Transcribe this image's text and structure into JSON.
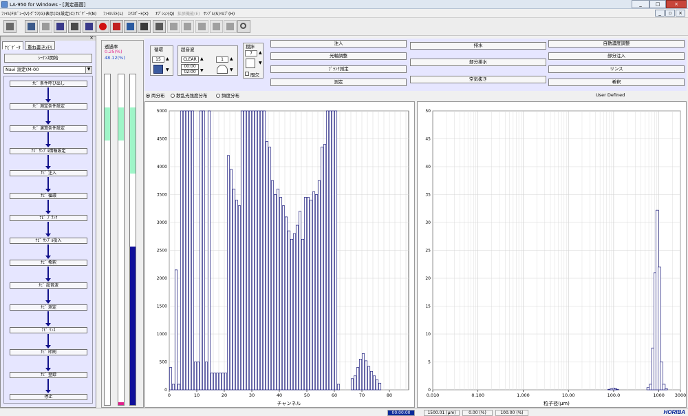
{
  "window": {
    "title": "LA-950 for Windows - [測定画面]",
    "min_label": "_",
    "restore_label": "□",
    "close_label": "×",
    "inner_min_label": "_",
    "inner_restore_label": "▫",
    "inner_close_label": "×"
  },
  "menu": [
    {
      "label": "ﾌｧｲﾙ(F)",
      "disabled": false
    },
    {
      "label": "ﾋﾞｭｰ(V)",
      "disabled": false
    },
    {
      "label": "ｸﾞﾗﾌ(G)",
      "disabled": false
    },
    {
      "label": "表示(D)",
      "disabled": false
    },
    {
      "label": "設定(C)",
      "disabled": false
    },
    {
      "label": "ﾅﾋﾞｹﾞｰﾀ(N)",
      "disabled": false
    },
    {
      "label": "ﾌｧｲﾙﾘｽﾄ(L)",
      "disabled": false
    },
    {
      "label": "ｴｸｽﾎﾟｰﾄ(X)",
      "disabled": false
    },
    {
      "label": "ｵﾌﾟｼｮﾝ(Q)",
      "disabled": false
    },
    {
      "label": "拡張機能(E)",
      "disabled": true
    },
    {
      "label": "ｻﾝﾌﾟﾙ(S)",
      "disabled": false
    },
    {
      "label": "ﾍﾙﾌﾟ(H)",
      "disabled": false
    }
  ],
  "toolbar_icons": [
    {
      "name": "folder-icon",
      "disabled": false,
      "color": "#6a6a6a"
    },
    {
      "name": "copy-windows-icon",
      "disabled": false,
      "color": "#3c5a8a"
    },
    {
      "name": "graph-icon",
      "disabled": true,
      "color": "#9a9a9a"
    },
    {
      "name": "keyboard-icon",
      "disabled": false,
      "color": "#3a3a8a"
    },
    {
      "name": "table-icon",
      "disabled": false,
      "color": "#4a4a4a"
    },
    {
      "name": "checklist-icon",
      "disabled": false,
      "color": "#3a3a8a"
    },
    {
      "name": "stop-icon",
      "disabled": false,
      "color": "#d01010"
    },
    {
      "name": "signpost-icon",
      "disabled": false,
      "color": "#c02020"
    },
    {
      "name": "print-preview-icon",
      "disabled": false,
      "color": "#2a5aa0"
    },
    {
      "name": "document-icon",
      "disabled": false,
      "color": "#3a3a3a"
    },
    {
      "name": "printer-icon",
      "disabled": false,
      "color": "#5a5a5a"
    },
    {
      "name": "layers-icon",
      "disabled": true,
      "color": "#a0a0a0"
    },
    {
      "name": "monitor-icon",
      "disabled": true,
      "color": "#a0a0a0"
    },
    {
      "name": "chart-window-icon",
      "disabled": true,
      "color": "#a0a0a0"
    },
    {
      "name": "scope-icon",
      "disabled": true,
      "color": "#a0a0a0"
    },
    {
      "name": "gauge-icon",
      "disabled": true,
      "color": "#a0a0a0"
    },
    {
      "name": "magnifier-icon",
      "disabled": false,
      "color": "#505050"
    }
  ],
  "navigator": {
    "close_label": "×",
    "tabs": [
      {
        "label": "ﾅﾋﾞｹﾞｰﾀ",
        "active": true
      },
      {
        "label": "重ね書きﾒﾓﾘ",
        "active": false
      }
    ],
    "sequence_button": "ｼｰｹﾝｽ開始",
    "select_value": "Navi 測定(M-00",
    "steps": [
      "ﾅﾋﾞ 条件呼び出し",
      "ﾅﾋﾞ 測定条件設定",
      "ﾅﾋﾞ 演算条件設定",
      "ﾅﾋﾞ ｻﾝﾌﾟﾙ情報設定",
      "ﾅﾋﾞ 注入",
      "ﾅﾋﾞ 循環",
      "ﾅﾋﾞ ﾌﾞﾗﾝｸ",
      "ﾅﾋﾞ ｻﾝﾌﾟﾙ投入",
      "ﾅﾋﾞ 希釈",
      "ﾅﾋﾞ 超音波",
      "ﾅﾋﾞ 測定",
      "ﾅﾋﾞ ﾘﾝｽ",
      "ﾅﾋﾞ 印刷",
      "ﾅﾋﾞ 登録",
      "停止"
    ]
  },
  "transmittance": {
    "label": "透過率",
    "value1": "0.25(%)",
    "value2": "48.12(%)",
    "value1_color": "#e0208a",
    "value2_color": "#1a4ad0",
    "gauges": [
      {
        "green_from": 0.1,
        "green_to": 0.2,
        "blue_level": 0,
        "pink": 0
      },
      {
        "green_from": 0.1,
        "green_to": 0.2,
        "blue_level": 0,
        "pink": 0.008
      },
      {
        "green_from": 0.1,
        "green_to": 0.3,
        "blue_level": 0.48,
        "pink": 0
      }
    ]
  },
  "controls": {
    "circulation": {
      "label": "循環",
      "value": "15"
    },
    "ultrasonic": {
      "label": "超音波",
      "clear_label": "CLEAR",
      "value": "1",
      "time1": "00:00",
      "time2": "02:00"
    },
    "stirring": {
      "label": "撹拌",
      "value": "7",
      "intermittent_label": "間欠"
    },
    "buttons": [
      "注入",
      "光軸調整",
      "ﾌﾞﾗﾝｸ測定",
      "測定",
      "排水",
      "部分排水",
      "空気抜き",
      "自動濃度調整",
      "部分注入",
      "リンス",
      "希釈"
    ],
    "user_defined": "User Defined"
  },
  "radio": [
    {
      "label": "両分布",
      "checked": true
    },
    {
      "label": "散乱光強度分布",
      "checked": false
    },
    {
      "label": "頻度分布",
      "checked": false
    }
  ],
  "chart_data": [
    {
      "type": "bar",
      "xlabel": "チャンネル",
      "xlim": [
        0,
        87
      ],
      "ylim": [
        0,
        5000
      ],
      "xticks": [
        0,
        10,
        20,
        30,
        40,
        50,
        60,
        70,
        80
      ],
      "yticks": [
        0,
        500,
        1000,
        1500,
        2000,
        2500,
        3000,
        3500,
        4000,
        4500,
        5000
      ],
      "grid": true,
      "values": [
        400,
        100,
        2150,
        100,
        5000,
        5000,
        5000,
        5000,
        5000,
        500,
        500,
        5000,
        5000,
        500,
        5000,
        300,
        300,
        300,
        300,
        300,
        300,
        4200,
        3950,
        3600,
        3400,
        3300,
        5000,
        5000,
        5000,
        5000,
        5000,
        5000,
        5000,
        5000,
        5000,
        4450,
        4350,
        3750,
        3500,
        3600,
        3450,
        3300,
        3100,
        2850,
        2700,
        2800,
        2950,
        3200,
        2700,
        3450,
        3450,
        3400,
        3550,
        3500,
        3750,
        4350,
        4400,
        5000,
        5000,
        5000,
        5000,
        100,
        0,
        0,
        0,
        0,
        200,
        250,
        400,
        550,
        650,
        520,
        420,
        330,
        250,
        180,
        120,
        0,
        0,
        0,
        0,
        0,
        0,
        0,
        0,
        0,
        0
      ]
    },
    {
      "type": "bar",
      "xlabel": "粒子径(μm)",
      "xscale": "log",
      "xlim": [
        0.01,
        3000
      ],
      "ylim": [
        0,
        50
      ],
      "xticks": [
        "0.010",
        "0.100",
        "1.000",
        "10.00",
        "100.0",
        "1000",
        "3000"
      ],
      "yticks": [
        0,
        5,
        10,
        15,
        20,
        25,
        30,
        35,
        40,
        45,
        50
      ],
      "grid": true,
      "x": [
        80,
        90,
        100,
        110,
        120,
        580,
        660,
        740,
        830,
        920,
        1030,
        1150,
        1290,
        1450
      ],
      "values": [
        0.1,
        0.2,
        0.3,
        0.2,
        0.1,
        0.4,
        1.0,
        7.5,
        21.0,
        32.2,
        22.0,
        5.0,
        1.0,
        0.2
      ]
    }
  ],
  "status": {
    "time": "00:00:00",
    "value1": "1500.01 (μm)",
    "value2": "0.00 (%)",
    "value3": "100.00 (%)",
    "brand": "HORIBA"
  }
}
